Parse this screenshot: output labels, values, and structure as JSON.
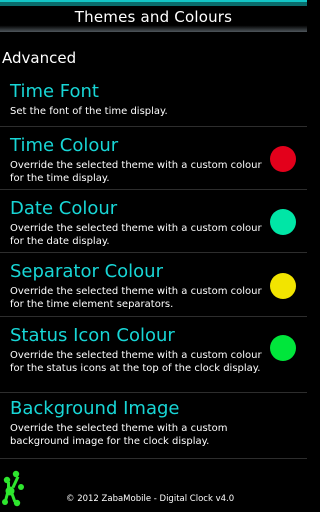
{
  "header": {
    "title": "Themes and Colours"
  },
  "section": {
    "title": "Advanced"
  },
  "preferences": [
    {
      "title": "Time Font",
      "summary": "Set the font of the time display.",
      "swatch_color": null
    },
    {
      "title": "Time Colour",
      "summary": "Override the selected theme with a custom colour for the time display.",
      "swatch_color": "#e3001b"
    },
    {
      "title": "Date Colour",
      "summary": "Override the selected theme with a custom colour for the date display.",
      "swatch_color": "#00e6a6"
    },
    {
      "title": "Separator Colour",
      "summary": "Override the selected theme with a custom colour for the time element separators.",
      "swatch_color": "#f2e400"
    },
    {
      "title": "Status Icon Colour",
      "summary": "Override the selected theme with a custom colour for the status icons at the top of the clock display.",
      "swatch_color": "#00e63b"
    },
    {
      "title": "Background Image",
      "summary": "Override the selected theme with a custom background image for the clock display.",
      "swatch_color": null
    }
  ],
  "footer": {
    "text": "© 2012 ZabaMobile - Digital Clock v4.0",
    "logo_icon": "frog-logo-icon"
  },
  "colors": {
    "accent": "#18d6d6",
    "background": "#000000"
  }
}
